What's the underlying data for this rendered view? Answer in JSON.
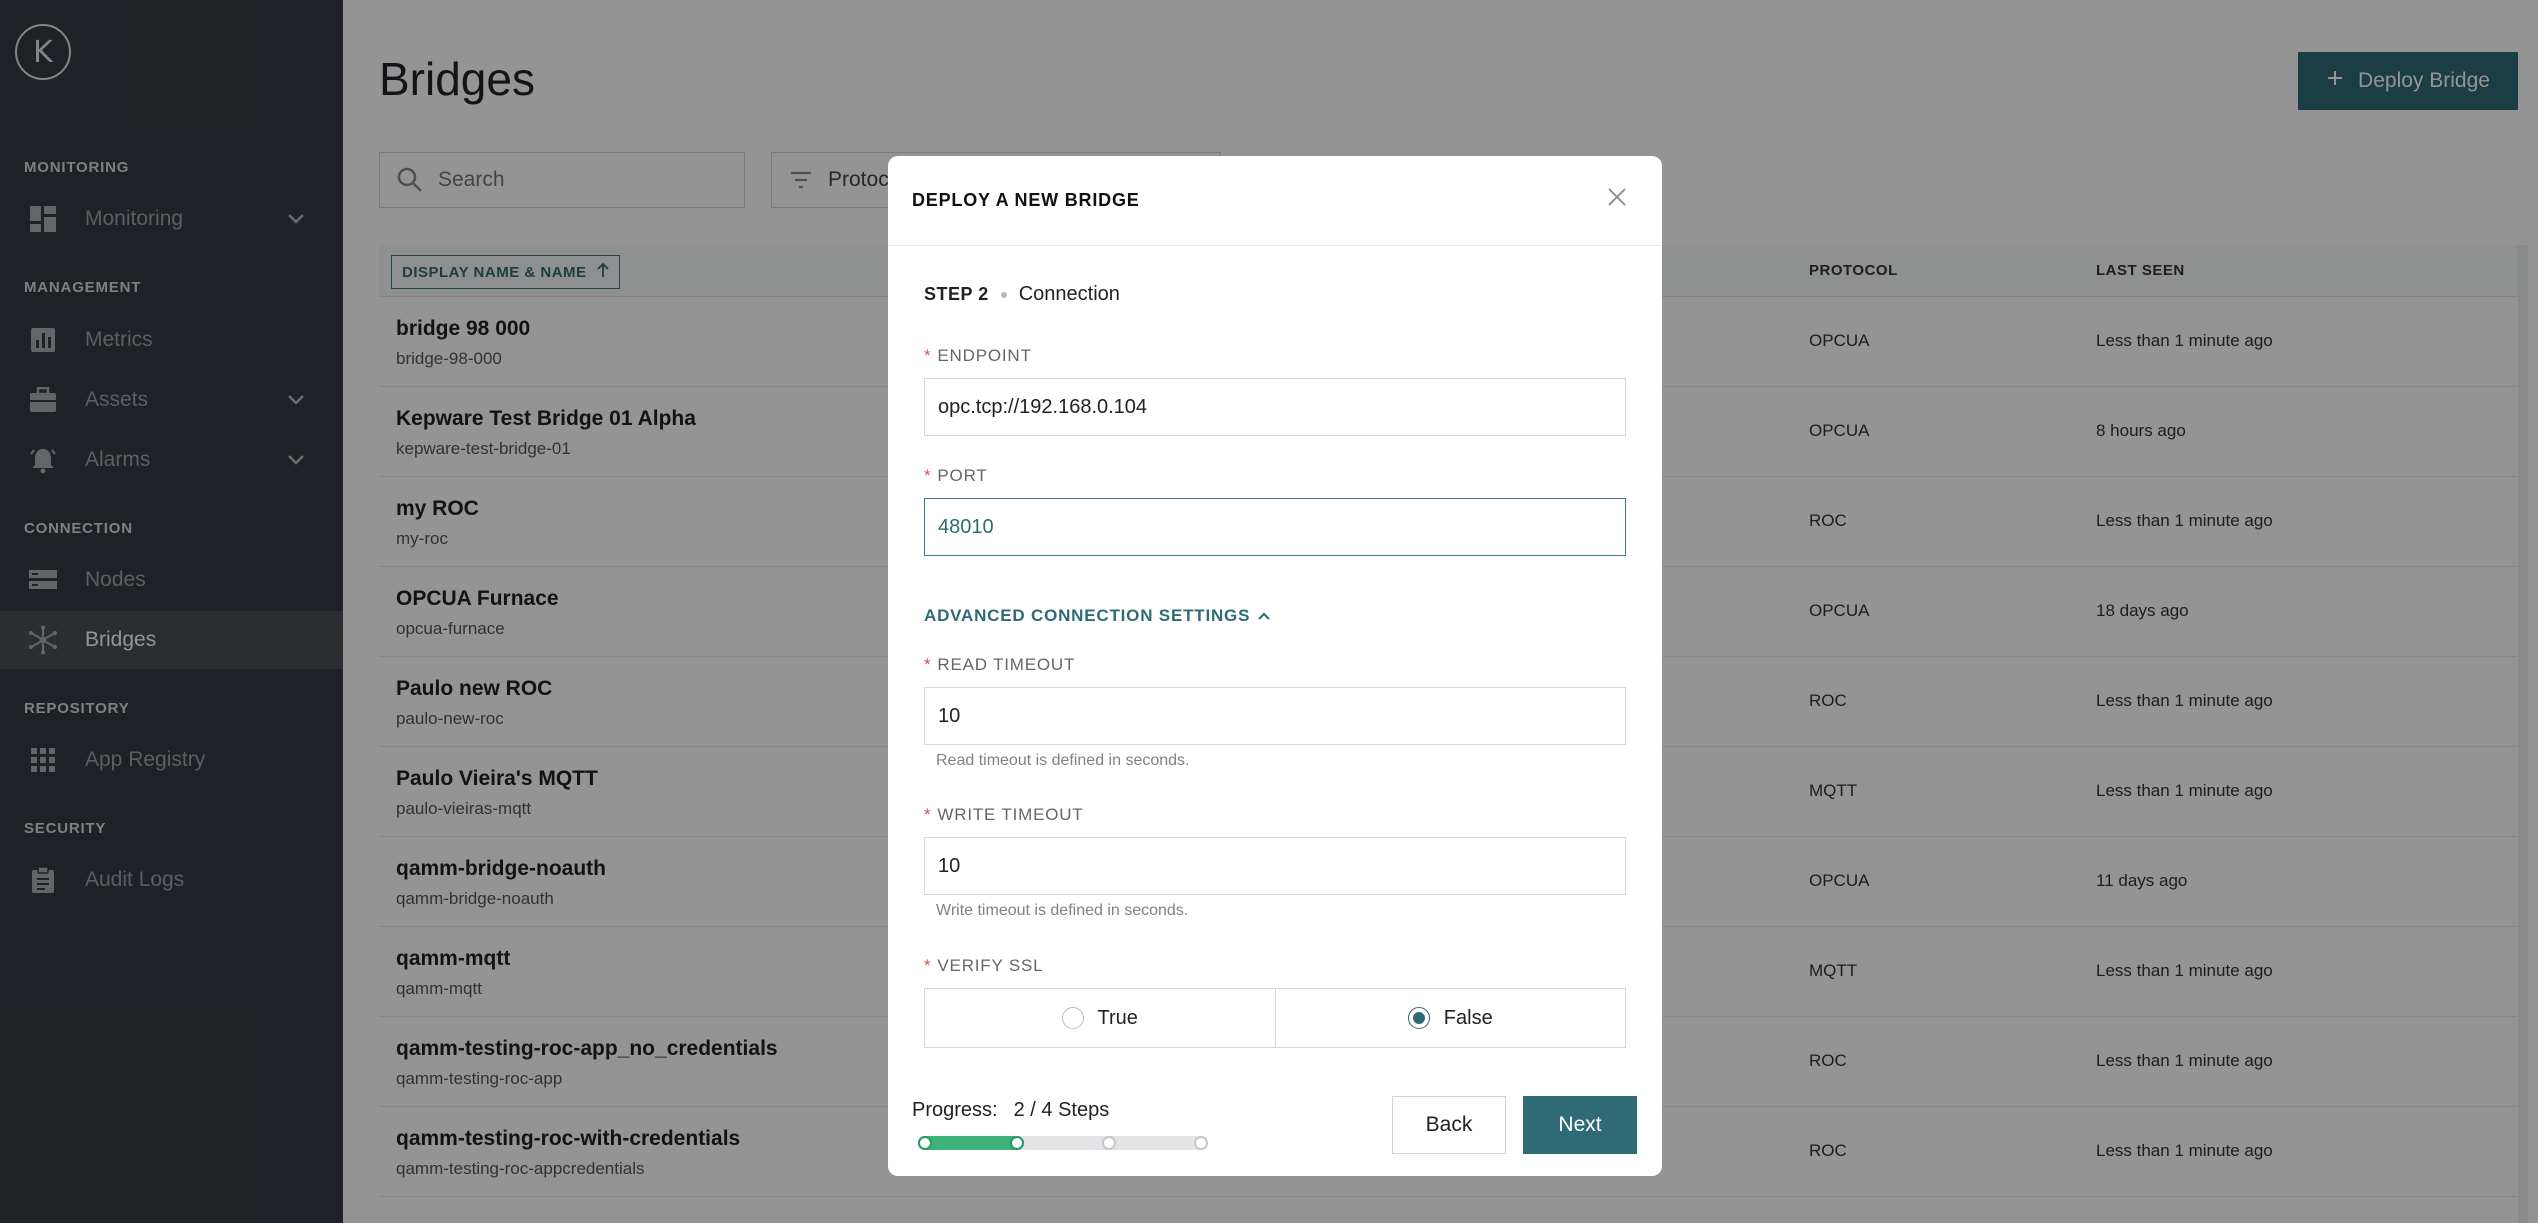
{
  "sidebar": {
    "logo_letter": "K",
    "sections": [
      {
        "title": "MONITORING",
        "items": [
          {
            "label": "Monitoring",
            "icon": "dashboard-icon",
            "chevron": true
          }
        ]
      },
      {
        "title": "MANAGEMENT",
        "items": [
          {
            "label": "Metrics",
            "icon": "metrics-icon",
            "chevron": false
          },
          {
            "label": "Assets",
            "icon": "assets-icon",
            "chevron": true
          },
          {
            "label": "Alarms",
            "icon": "alarm-icon",
            "chevron": true
          }
        ]
      },
      {
        "title": "CONNECTION",
        "items": [
          {
            "label": "Nodes",
            "icon": "nodes-icon",
            "chevron": false
          },
          {
            "label": "Bridges",
            "icon": "bridges-icon",
            "chevron": false,
            "active": true
          }
        ]
      },
      {
        "title": "REPOSITORY",
        "items": [
          {
            "label": "App Registry",
            "icon": "grid-icon",
            "chevron": false
          }
        ]
      },
      {
        "title": "SECURITY",
        "items": [
          {
            "label": "Audit Logs",
            "icon": "clipboard-icon",
            "chevron": false
          }
        ]
      }
    ]
  },
  "header": {
    "title": "Bridges",
    "deploy_label": "Deploy Bridge"
  },
  "search": {
    "placeholder": "Search"
  },
  "filter": {
    "label": "Protoco"
  },
  "table": {
    "sort_column": "DISPLAY NAME & NAME",
    "columns": {
      "protocol": "PROTOCOL",
      "last_seen": "LAST SEEN"
    },
    "rows": [
      {
        "name": "bridge 98 000",
        "id": "bridge-98-000",
        "protocol": "OPCUA",
        "last_seen": "Less than 1 minute ago"
      },
      {
        "name": "Kepware Test Bridge 01 Alpha",
        "id": "kepware-test-bridge-01",
        "protocol": "OPCUA",
        "last_seen": "8 hours ago"
      },
      {
        "name": "my ROC",
        "id": "my-roc",
        "protocol": "ROC",
        "last_seen": "Less than 1 minute ago"
      },
      {
        "name": "OPCUA Furnace",
        "id": "opcua-furnace",
        "protocol": "OPCUA",
        "last_seen": "18 days ago"
      },
      {
        "name": "Paulo new ROC",
        "id": "paulo-new-roc",
        "protocol": "ROC",
        "last_seen": "Less than 1 minute ago"
      },
      {
        "name": "Paulo Vieira's MQTT",
        "id": "paulo-vieiras-mqtt",
        "protocol": "MQTT",
        "last_seen": "Less than 1 minute ago"
      },
      {
        "name": "qamm-bridge-noauth",
        "id": "qamm-bridge-noauth",
        "protocol": "OPCUA",
        "last_seen": "11 days ago"
      },
      {
        "name": "qamm-mqtt",
        "id": "qamm-mqtt",
        "protocol": "MQTT",
        "last_seen": "Less than 1 minute ago"
      },
      {
        "name": "qamm-testing-roc-app_no_credentials",
        "id": "qamm-testing-roc-app",
        "protocol": "ROC",
        "last_seen": "Less than 1 minute ago"
      },
      {
        "name": "qamm-testing-roc-with-credentials",
        "id": "qamm-testing-roc-appcredentials",
        "protocol": "ROC",
        "last_seen": "Less than 1 minute ago"
      }
    ]
  },
  "modal": {
    "title": "DEPLOY A NEW BRIDGE",
    "step_number": "STEP 2",
    "step_name": "Connection",
    "endpoint": {
      "label": "ENDPOINT",
      "value": "opc.tcp://192.168.0.104"
    },
    "port": {
      "label": "PORT",
      "value": "48010"
    },
    "advanced_label": "ADVANCED CONNECTION SETTINGS",
    "read_timeout": {
      "label": "READ TIMEOUT",
      "value": "10",
      "hint": "Read timeout is defined in seconds."
    },
    "write_timeout": {
      "label": "WRITE TIMEOUT",
      "value": "10",
      "hint": "Write timeout is defined in seconds."
    },
    "verify_ssl": {
      "label": "VERIFY SSL",
      "options": [
        "True",
        "False"
      ],
      "selected": "False"
    },
    "progress": {
      "label": "Progress:",
      "text": "2 / 4 Steps",
      "current": 2,
      "total": 4
    },
    "back_label": "Back",
    "next_label": "Next"
  },
  "colors": {
    "accent": "#2e6b74",
    "sidebar": "#343a40",
    "progress": "#3db37a",
    "required": "#d9534f"
  }
}
